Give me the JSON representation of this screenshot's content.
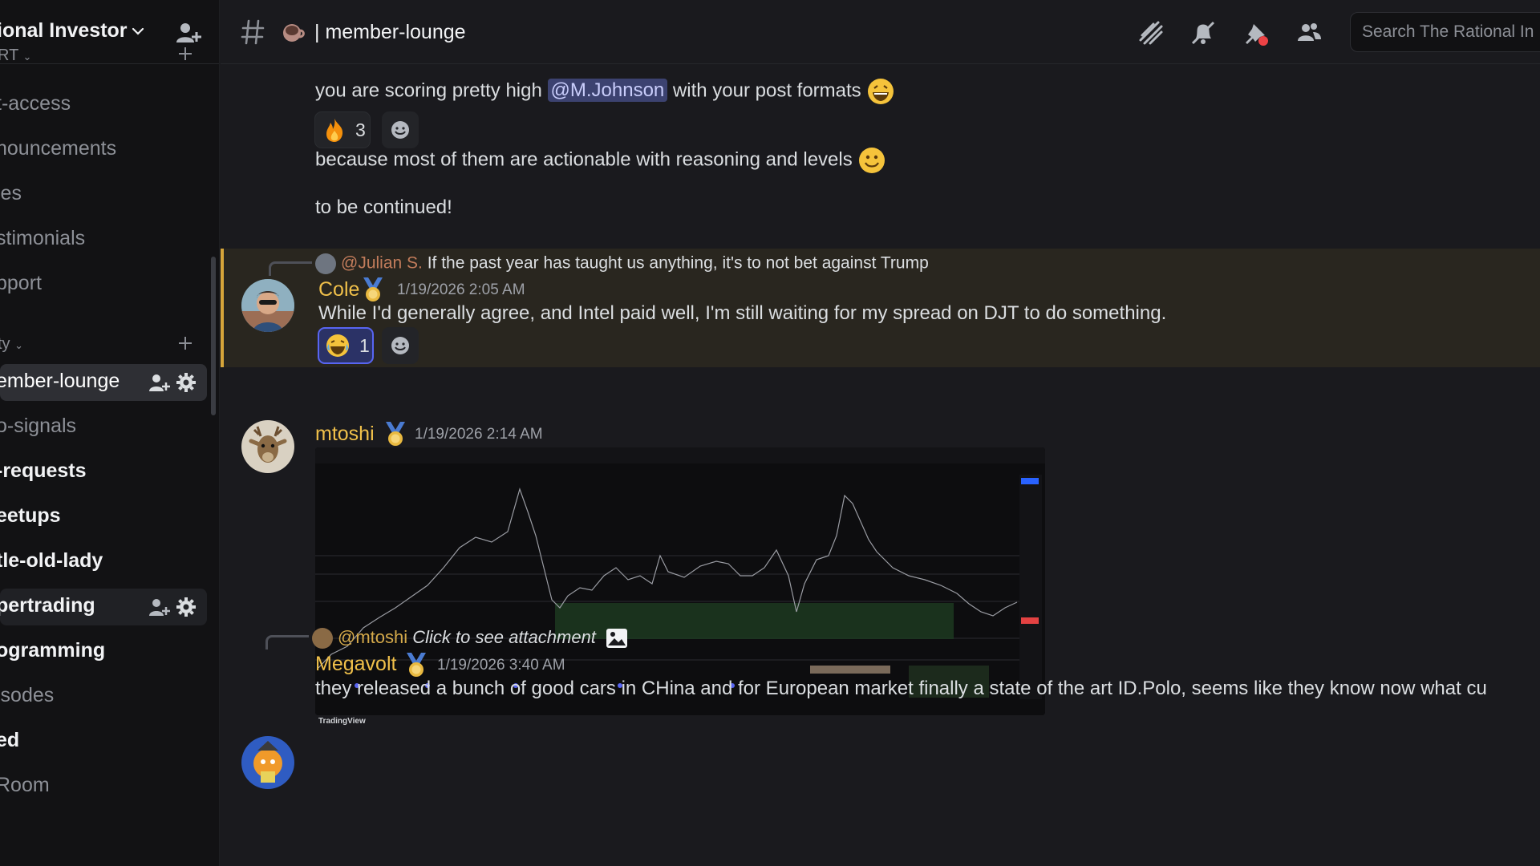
{
  "server": {
    "name": "ional Investor"
  },
  "sidebar": {
    "categories": [
      {
        "label": "RT",
        "top": 0
      },
      {
        "label": "ty"
      }
    ],
    "channels": [
      {
        "label": "t-access"
      },
      {
        "label": "nouncements"
      },
      {
        "label": "les"
      },
      {
        "label": "stimonials"
      },
      {
        "label": "pport"
      },
      {
        "label": "ember-lounge"
      },
      {
        "label": "o-signals"
      },
      {
        "label": "-requests"
      },
      {
        "label": "eetups"
      },
      {
        "label": "tle-old-lady"
      },
      {
        "label": "pertrading"
      },
      {
        "label": "ogramming"
      },
      {
        "label": "isodes"
      },
      {
        "label": "ed"
      },
      {
        "label": "Room"
      }
    ]
  },
  "topbar": {
    "channel": "| member-lounge",
    "search_placeholder": "Search The Rational In"
  },
  "messages": {
    "m0": {
      "line1_a": "you are scoring pretty high ",
      "line1_mention": "@M.Johnson",
      "line1_b": " with your post formats",
      "reaction_count": "3",
      "line2": "because most of them are actionable with reasoning and levels",
      "line3": "to be continued!"
    },
    "m1": {
      "reply_user": "@Julian S.",
      "reply_text": "If the past year has taught us anything, it's to not bet against Trump",
      "username": "Cole",
      "timestamp": "1/19/2026 2:05 AM",
      "text": "While I'd generally agree, and Intel paid well, I'm still waiting for my spread on DJT to do something.",
      "reaction_count": "1"
    },
    "m2": {
      "username": "mtoshi",
      "timestamp": "1/19/2026 2:14 AM",
      "attachment_brand": "TradingView"
    },
    "m3": {
      "reply_user": "@mtoshi",
      "reply_text": "Click to see attachment",
      "username": "Megavolt",
      "timestamp": "1/19/2026 3:40 AM",
      "text": "they released a bunch of good cars in CHina and for European market finally a state of the art ID.Polo, seems like they know now what cu"
    }
  },
  "colors": {
    "accent": "#5865f2",
    "username": "#f0c04a",
    "highlight": "#d6a53a",
    "background": "#1a1a1e"
  }
}
